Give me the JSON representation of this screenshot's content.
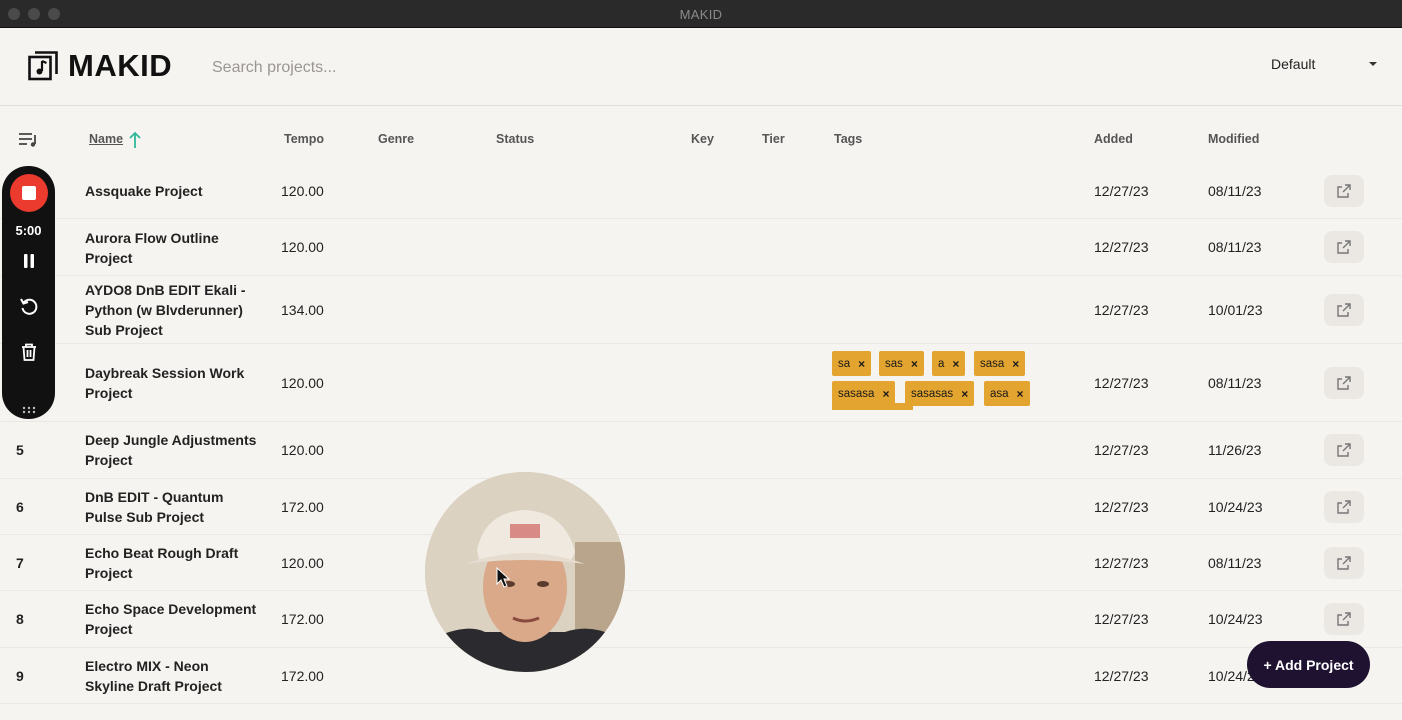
{
  "window": {
    "title": "MAKID"
  },
  "header": {
    "logo_text": "MAKID",
    "search_placeholder": "Search projects...",
    "sort_value": "Default"
  },
  "table": {
    "columns": {
      "name": "Name",
      "tempo": "Tempo",
      "genre": "Genre",
      "status": "Status",
      "key": "Key",
      "tier": "Tier",
      "tags": "Tags",
      "added": "Added",
      "modified": "Modified"
    },
    "rows": [
      {
        "num": "",
        "name": "Assquake Project",
        "tempo": "120.00",
        "added": "12/27/23",
        "modified": "08/11/23",
        "tags": []
      },
      {
        "num": "",
        "name": "Aurora Flow Outline Project",
        "tempo": "120.00",
        "added": "12/27/23",
        "modified": "08/11/23",
        "tags": []
      },
      {
        "num": "",
        "name": "AYDO8 DnB EDIT Ekali - Python (w Blvderunner) Sub Project",
        "tempo": "134.00",
        "added": "12/27/23",
        "modified": "10/01/23",
        "tags": []
      },
      {
        "num": "",
        "name": "Daybreak Session Work Project",
        "tempo": "120.00",
        "added": "12/27/23",
        "modified": "08/11/23",
        "tags": [
          "sa",
          "sas",
          "a",
          "sasa",
          "sasasa",
          "sasasas",
          "asa"
        ]
      },
      {
        "num": "5",
        "name": "Deep Jungle Adjustments Project",
        "tempo": "120.00",
        "added": "12/27/23",
        "modified": "11/26/23",
        "tags": []
      },
      {
        "num": "6",
        "name": "DnB EDIT - Quantum Pulse Sub Project",
        "tempo": "172.00",
        "added": "12/27/23",
        "modified": "10/24/23",
        "tags": []
      },
      {
        "num": "7",
        "name": "Echo Beat Rough Draft Project",
        "tempo": "120.00",
        "added": "12/27/23",
        "modified": "08/11/23",
        "tags": []
      },
      {
        "num": "8",
        "name": "Echo Space Development Project",
        "tempo": "172.00",
        "added": "12/27/23",
        "modified": "10/24/23",
        "tags": []
      },
      {
        "num": "9",
        "name": "Electro MIX - Neon Skyline Draft Project",
        "tempo": "172.00",
        "added": "12/27/23",
        "modified": "10/24/23",
        "tags": []
      }
    ]
  },
  "recorder": {
    "time": "5:00"
  },
  "actions": {
    "add_project": "+ Add Project"
  },
  "icons": {
    "logo": "music-note-icon",
    "list": "playlist-icon",
    "sort": "arrow-up-icon",
    "open": "open-external-icon",
    "stop": "stop-icon",
    "pause": "pause-icon",
    "restart": "restart-icon",
    "delete": "trash-icon"
  },
  "colors": {
    "tag": "#e3a52f",
    "accent_button": "#1f1130",
    "record": "#ea3b2e",
    "sort_arrow": "#2fb89a"
  }
}
